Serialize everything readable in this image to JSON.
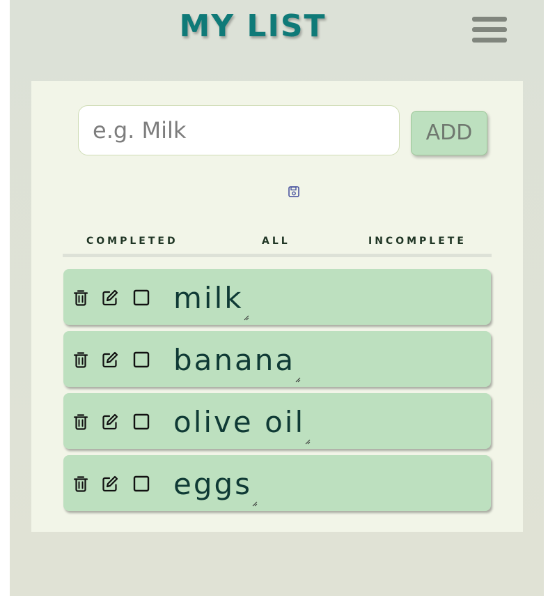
{
  "header": {
    "title": "MY LIST"
  },
  "form": {
    "placeholder": "e.g. Milk",
    "value": "",
    "add_label": "ADD"
  },
  "filters": {
    "completed": "COMPLETED",
    "all": "ALL",
    "incomplete": "INCOMPLETE"
  },
  "items": [
    {
      "text": "milk",
      "completed": false
    },
    {
      "text": "banana",
      "completed": false
    },
    {
      "text": "olive oil",
      "completed": false
    },
    {
      "text": "eggs",
      "completed": false
    }
  ],
  "icons": {
    "menu": "hamburger-menu-icon",
    "save": "save-icon",
    "delete": "trash-icon",
    "edit": "edit-icon",
    "checkbox": "checkbox-icon"
  },
  "colors": {
    "title": "#0f7a78",
    "item_background": "#bde0bf",
    "panel_background": "#f2f5e8",
    "app_background": "#dce1d7",
    "item_text": "#0f3a35"
  }
}
